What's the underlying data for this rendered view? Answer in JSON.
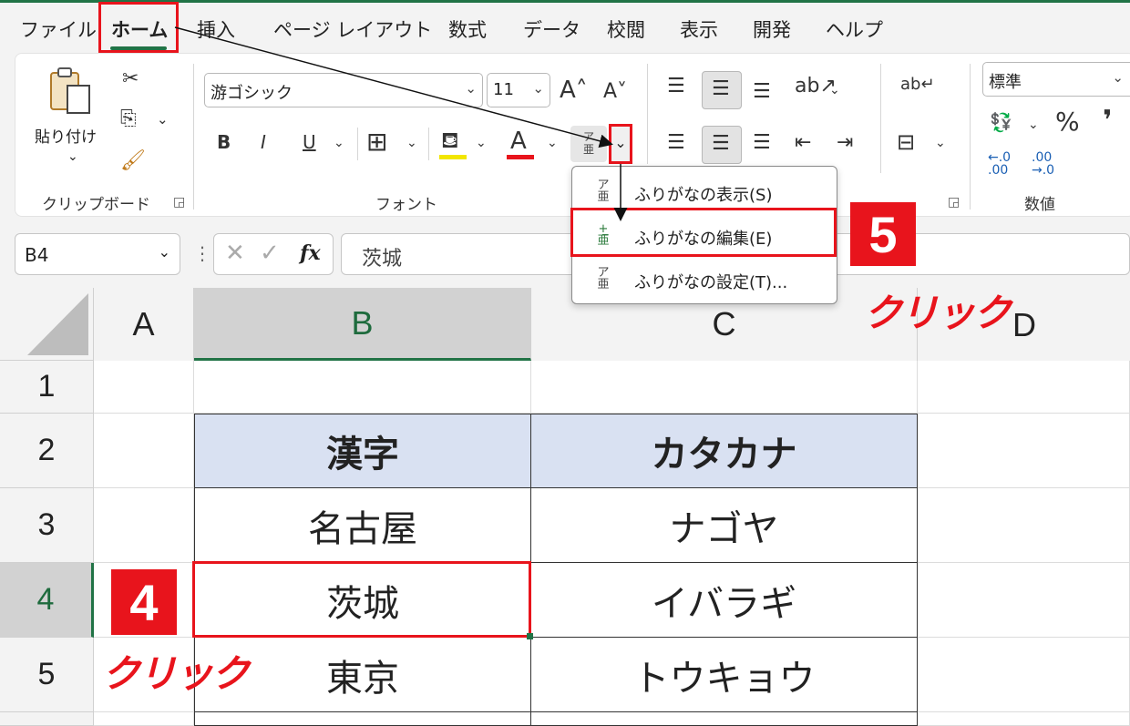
{
  "menu": {
    "tabs": [
      "ファイル",
      "ホーム",
      "挿入",
      "ページ レイアウト",
      "数式",
      "データ",
      "校閲",
      "表示",
      "開発",
      "ヘルプ"
    ],
    "active_tab": "ホーム"
  },
  "ribbon": {
    "clipboard": {
      "paste_label": "貼り付け",
      "group_label": "クリップボード"
    },
    "font": {
      "font_name": "游ゴシック",
      "font_size": "11",
      "bold": "B",
      "italic": "I",
      "underline": "U",
      "group_label": "フォント"
    },
    "number": {
      "format": "標準",
      "group_label": "数値",
      "percent": "%",
      "comma": "❜"
    }
  },
  "formula_bar": {
    "name_box": "B4",
    "fx": "fx",
    "formula": "茨城"
  },
  "sheet": {
    "columns": [
      "A",
      "B",
      "C",
      "D"
    ],
    "rows": [
      "1",
      "2",
      "3",
      "4",
      "5"
    ],
    "table": [
      [
        "漢字",
        "カタカナ"
      ],
      [
        "名古屋",
        "ナゴヤ"
      ],
      [
        "茨城",
        "イバラギ"
      ],
      [
        "東京",
        "トウキョウ"
      ]
    ]
  },
  "furigana_menu": {
    "items": [
      {
        "label": "ふりがなの表示(S)",
        "icon": "furigana-show-icon"
      },
      {
        "label": "ふりがなの編集(E)",
        "icon": "furigana-edit-icon"
      },
      {
        "label": "ふりがなの設定(T)...",
        "icon": "furigana-settings-icon"
      }
    ]
  },
  "annotations": {
    "step4": "4",
    "step5": "5",
    "click_text": "クリック"
  },
  "colors": {
    "accent": "#217346",
    "highlight_red": "#e8141c",
    "header_fill": "#d9e1f2"
  }
}
